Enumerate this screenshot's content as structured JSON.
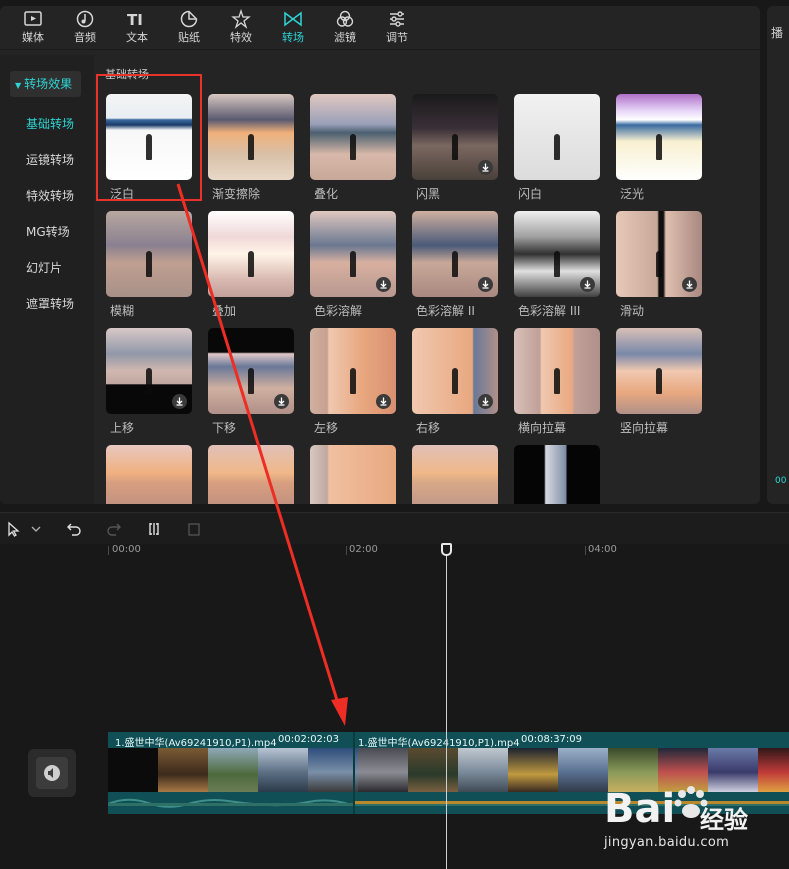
{
  "toolbar": {
    "tabs": [
      {
        "label": "媒体",
        "icon": "media-icon"
      },
      {
        "label": "音频",
        "icon": "audio-icon"
      },
      {
        "label": "文本",
        "icon": "text-icon"
      },
      {
        "label": "贴纸",
        "icon": "sticker-icon"
      },
      {
        "label": "特效",
        "icon": "effects-icon"
      },
      {
        "label": "转场",
        "icon": "transition-icon",
        "active": true
      },
      {
        "label": "滤镜",
        "icon": "filter-icon"
      },
      {
        "label": "调节",
        "icon": "adjust-icon"
      }
    ]
  },
  "sidebar": {
    "header": "转场效果",
    "items": [
      "基础转场",
      "运镜转场",
      "特效转场",
      "MG转场",
      "幻灯片",
      "遮罩转场"
    ],
    "selected_index": 0
  },
  "content": {
    "section_title": "基础转场",
    "items": [
      {
        "label": "泛白"
      },
      {
        "label": "渐变擦除"
      },
      {
        "label": "叠化"
      },
      {
        "label": "闪黑"
      },
      {
        "label": "闪白"
      },
      {
        "label": "泛光"
      },
      {
        "label": "模糊"
      },
      {
        "label": "叠加"
      },
      {
        "label": "色彩溶解"
      },
      {
        "label": "色彩溶解 II"
      },
      {
        "label": "色彩溶解 III"
      },
      {
        "label": "滑动"
      },
      {
        "label": "上移"
      },
      {
        "label": "下移"
      },
      {
        "label": "左移"
      },
      {
        "label": "右移"
      },
      {
        "label": "横向拉幕"
      },
      {
        "label": "竖向拉幕"
      }
    ]
  },
  "right_panel": {
    "title_fragment": "播",
    "time_fragment": "00"
  },
  "timeline": {
    "ruler": [
      "00:00",
      "02:00",
      "04:00"
    ],
    "clips": [
      {
        "name": "1.盛世中华(Av69241910,P1).mp4",
        "duration": "00:02:02:03"
      },
      {
        "name": "1.盛世中华(Av69241910,P1).mp4",
        "duration": "00:08:37:09"
      }
    ]
  },
  "watermark": {
    "brand": "Bai",
    "brand_cn": "经验",
    "url": "jingyan.baidu.com"
  },
  "colors": {
    "accent": "#2fd4d4",
    "highlight": "#e8322a",
    "track": "#0f4f55"
  }
}
